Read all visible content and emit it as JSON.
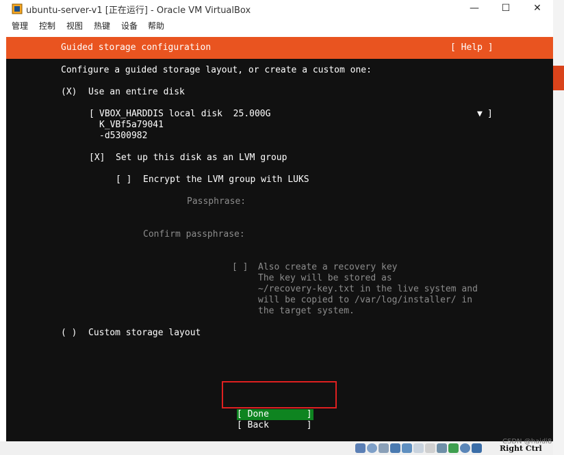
{
  "window": {
    "title": "ubuntu-server-v1 [正在运行] - Oracle VM VirtualBox",
    "minimize_glyph": "—",
    "maximize_glyph": "☐",
    "close_glyph": "✕"
  },
  "menu": {
    "items": [
      "管理",
      "控制",
      "视图",
      "热键",
      "设备",
      "帮助"
    ]
  },
  "installer": {
    "header_title": "Guided storage configuration",
    "help_label": "[ Help ]",
    "prompt": "Configure a guided storage layout, or create a custom one:",
    "entire_disk": {
      "marker": "(X)",
      "label": "Use an entire disk"
    },
    "disk_select": {
      "open_bracket": "[",
      "line1": "VBOX_HARDDIS local disk  25.000G",
      "line2": "K_VBf5a79041",
      "line3": "-d5300982",
      "arrow": "▼",
      "close_bracket": "]"
    },
    "lvm": {
      "marker": "[X]",
      "label": "Set up this disk as an LVM group"
    },
    "luks": {
      "marker": "[ ]",
      "label": "Encrypt the LVM group with LUKS"
    },
    "passphrase_label": "Passphrase:",
    "confirm_passphrase_label": "Confirm passphrase:",
    "recovery": {
      "marker": "[ ]",
      "line1": "Also create a recovery key",
      "line2": "The key will be stored as",
      "line3": "~/recovery-key.txt in the live system and",
      "line4": "will be copied to /var/log/installer/ in",
      "line5": "the target system."
    },
    "custom": {
      "marker": "( )",
      "label": "Custom storage layout"
    },
    "done_label": "[ Done       ]",
    "back_label": "[ Back       ]"
  },
  "statusbar": {
    "host_key": "Right Ctrl"
  },
  "watermark": "CSDN @haidi8",
  "colors": {
    "header_orange": "#e95420",
    "done_green": "#0e8420",
    "terminal_bg": "#111111",
    "highlight_red": "#e02020"
  },
  "icons": {
    "app": "virtualbox-icon",
    "status": [
      "hard-disk-icon",
      "optical-drive-icon",
      "audio-icon",
      "network-icon",
      "usb-icon",
      "shared-folders-icon",
      "display-icon",
      "video-capture-icon",
      "cpu-icon",
      "mouse-integration-icon",
      "keyboard-icon"
    ]
  }
}
